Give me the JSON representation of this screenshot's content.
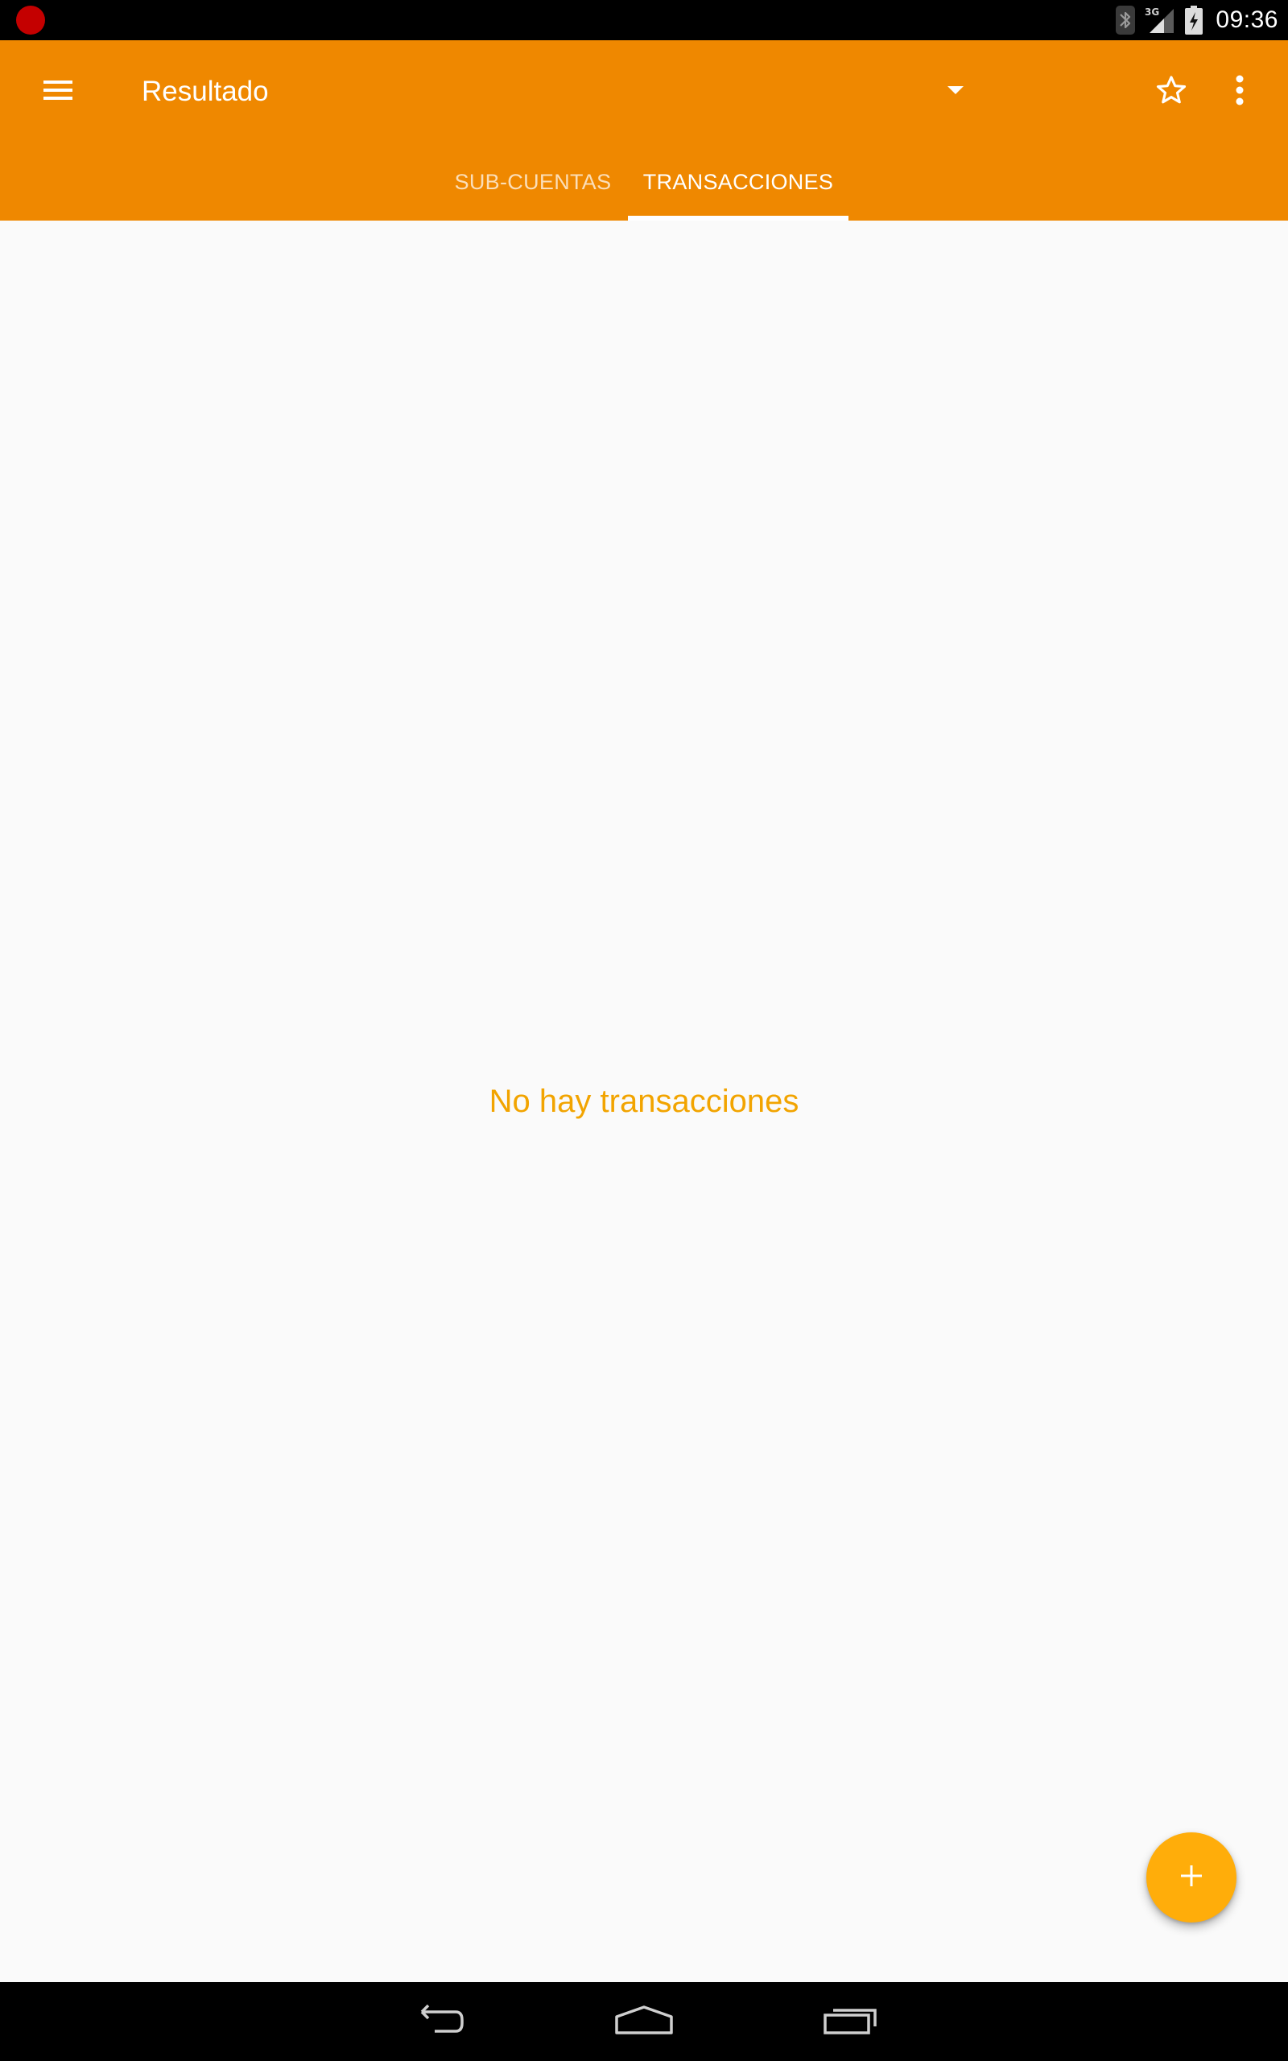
{
  "status_bar": {
    "time": "09:36",
    "network_label": "3G",
    "icons": [
      "recording-icon",
      "bluetooth-icon",
      "signal-icon",
      "battery-charging-icon"
    ]
  },
  "toolbar": {
    "title": "Resultado",
    "icons": {
      "menu": "hamburger-menu-icon",
      "dropdown": "dropdown-arrow-icon",
      "favorite": "star-outline-icon",
      "overflow": "more-vert-icon"
    }
  },
  "tabs": [
    {
      "label": "SUB-CUENTAS",
      "selected": false
    },
    {
      "label": "TRANSACCIONES",
      "selected": true
    }
  ],
  "content": {
    "empty_message": "No hay transacciones"
  },
  "fab": {
    "icon": "plus-icon"
  },
  "nav_bar": {
    "icons": [
      "back-icon",
      "home-icon",
      "recents-icon"
    ]
  },
  "colors": {
    "app_bar": "#ef8800",
    "accent": "#ffad0a",
    "empty_text": "#f2a400",
    "background": "#fafafa",
    "system_bars": "#000000"
  }
}
